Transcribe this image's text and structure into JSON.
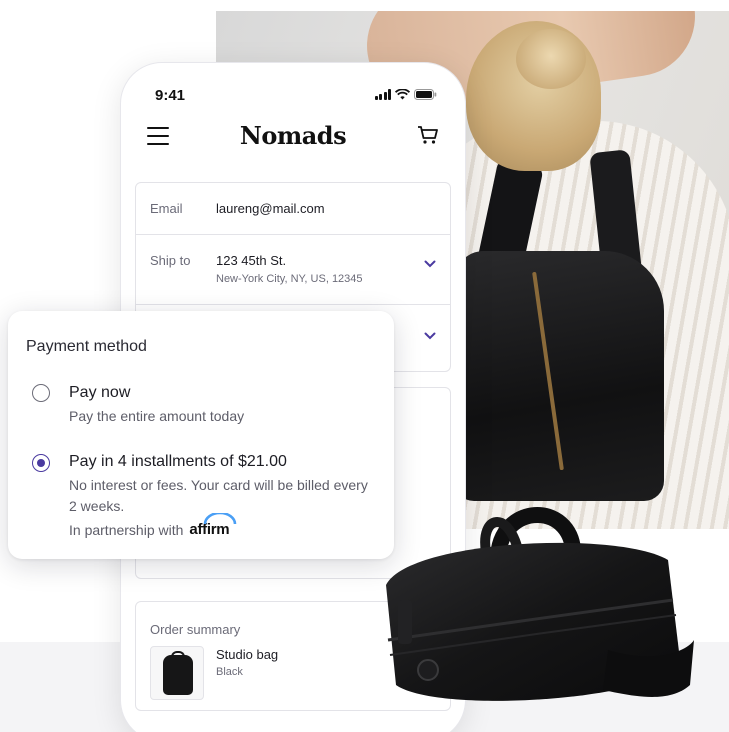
{
  "status_bar": {
    "time": "9:41"
  },
  "header": {
    "brand": "Nomads"
  },
  "checkout": {
    "email_label": "Email",
    "email_value": "laureng@mail.com",
    "ship_label": "Ship to",
    "ship_street": "123 45th St.",
    "ship_city": "New-York City, NY, US, 12345"
  },
  "payment": {
    "title": "Payment method",
    "options": [
      {
        "title": "Pay now",
        "desc": "Pay the entire amount today",
        "selected": false
      },
      {
        "title": "Pay in 4 installments of $21.00",
        "desc": "No interest or fees. Your card will be billed every 2 weeks.",
        "selected": true
      }
    ],
    "partner_text": "In partnership with",
    "partner_logo": "affirm"
  },
  "order_summary": {
    "title": "Order summary",
    "item_name": "Studio bag",
    "item_variant": "Black"
  },
  "colors": {
    "accent": "#4a3aa0",
    "text": "#1d1d24",
    "muted": "#6b6b78"
  },
  "icons": [
    "menu-icon",
    "cart-icon",
    "chevron-down-icon",
    "signal-icon",
    "wifi-icon",
    "battery-icon"
  ]
}
